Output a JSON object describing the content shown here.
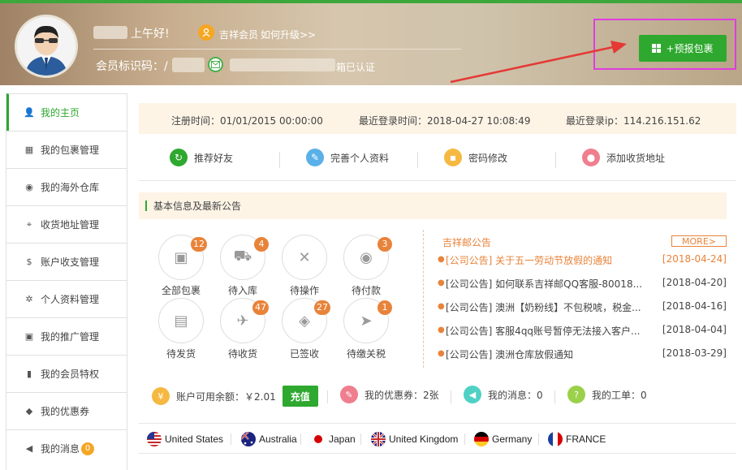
{
  "header": {
    "greeting": "上午好!",
    "vip_label": "吉祥会员",
    "vip_upgrade_link": "如何升级>>",
    "member_id_label": "会员标识码：",
    "member_id_prefix": "/",
    "verified_text": "箱已认证",
    "prebook_button": "+预报包裹"
  },
  "sidebar": {
    "items": [
      {
        "label": "我的主页",
        "icon": "user-icon"
      },
      {
        "label": "我的包裹管理",
        "icon": "grid-icon"
      },
      {
        "label": "我的海外仓库",
        "icon": "globe-icon"
      },
      {
        "label": "收货地址管理",
        "icon": "location-icon"
      },
      {
        "label": "账户收支管理",
        "icon": "dollar-icon"
      },
      {
        "label": "个人资料管理",
        "icon": "gear-icon"
      },
      {
        "label": "我的推广管理",
        "icon": "gift-icon"
      },
      {
        "label": "我的会员特权",
        "icon": "bookmark-icon"
      },
      {
        "label": "我的优惠券",
        "icon": "tag-icon"
      },
      {
        "label": "我的消息",
        "icon": "volume-icon",
        "badge": "0"
      }
    ]
  },
  "login_info": {
    "register_time": "注册时间：01/01/2015 00:00:00",
    "last_login_time": "最近登录时间：2018-04-27 10:08:49",
    "last_login_ip": "最近登录ip：114.216.151.62"
  },
  "shortcuts": [
    {
      "label": "推荐好友",
      "icon": "share-icon",
      "color": "#2ea82e"
    },
    {
      "label": "完善个人资料",
      "icon": "edit-icon",
      "color": "#5ab0e8"
    },
    {
      "label": "密码修改",
      "icon": "lock-icon",
      "color": "#f5b942"
    },
    {
      "label": "添加收货地址",
      "icon": "pin-icon",
      "color": "#ef7e8e"
    }
  ],
  "section_title": "基本信息及最新公告",
  "package_status": [
    {
      "label": "全部包裹",
      "count": "12",
      "icon": "box-icon"
    },
    {
      "label": "待入库",
      "count": "4",
      "icon": "cart-icon"
    },
    {
      "label": "待操作",
      "count": "",
      "icon": "tools-icon"
    },
    {
      "label": "待付款",
      "count": "3",
      "icon": "moneybag-icon"
    },
    {
      "label": "待发货",
      "count": "",
      "icon": "document-icon"
    },
    {
      "label": "待收货",
      "count": "47",
      "icon": "plane-icon"
    },
    {
      "label": "已签收",
      "count": "27",
      "icon": "layers-icon"
    },
    {
      "label": "待缴关税",
      "count": "1",
      "icon": "send-icon"
    }
  ],
  "notices": {
    "title": "吉祥邮公告",
    "more": "MORE>",
    "items": [
      {
        "text": "[公司公告] 关于五一劳动节放假的通知",
        "date": "[2018-04-24]",
        "highlight": true
      },
      {
        "text": "[公司公告] 如何联系吉祥邮QQ客服-80018...",
        "date": "[2018-04-20]",
        "highlight": false
      },
      {
        "text": "[公司公告] 澳洲【奶粉线】不包税唬，税金...",
        "date": "[2018-04-16]",
        "highlight": false
      },
      {
        "text": "[公司公告] 客服4qq账号暂停无法接入客户...",
        "date": "[2018-04-04]",
        "highlight": false
      },
      {
        "text": "[公司公告] 澳洲仓库放假通知",
        "date": "[2018-03-29]",
        "highlight": false
      }
    ]
  },
  "stats": {
    "balance_label": "账户可用余额：",
    "balance_value": "￥2.01",
    "recharge_button": "充值",
    "coupons": "我的优惠券：2张",
    "messages": "我的消息：0",
    "tickets": "我的工单：0"
  },
  "countries": [
    {
      "name": "United States",
      "flag": "us-flag-icon"
    },
    {
      "name": "Australia",
      "flag": "au-flag-icon"
    },
    {
      "name": "Japan",
      "flag": "jp-flag-icon"
    },
    {
      "name": "United Kingdom",
      "flag": "uk-flag-icon"
    },
    {
      "name": "Germany",
      "flag": "de-flag-icon"
    },
    {
      "name": "FRANCE",
      "flag": "fr-flag-icon"
    }
  ],
  "colors": {
    "accent_green": "#2ea82e",
    "accent_orange": "#e8833a",
    "annotation_magenta": "#e03ce0",
    "annotation_red": "#e53935"
  }
}
